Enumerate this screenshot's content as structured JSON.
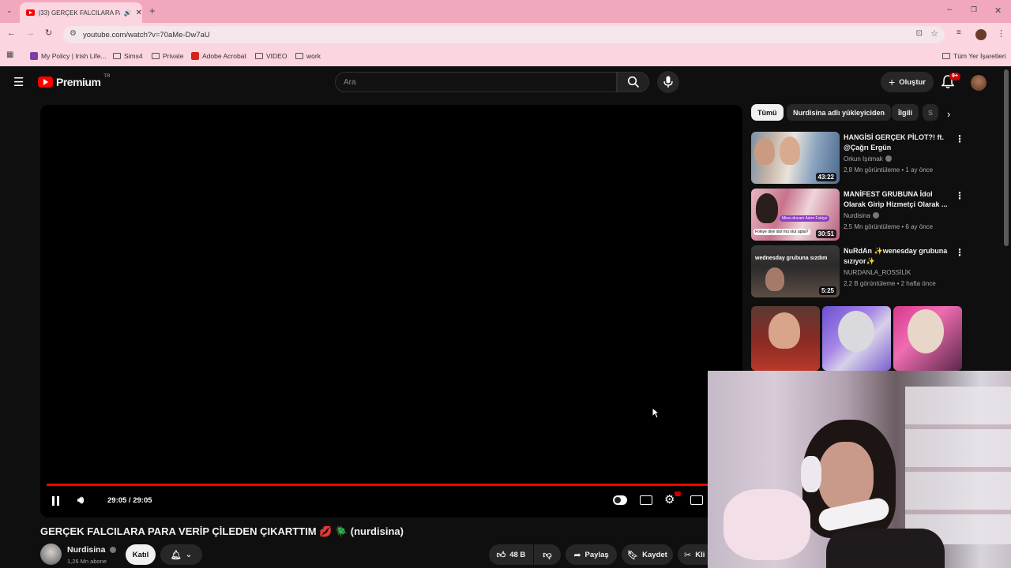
{
  "browser": {
    "tab_title": "(33) GERÇEK FALCILARA PA",
    "url": "youtube.com/watch?v=70aMe-Dw7aU",
    "bookmarks": [
      "My Policy | Irish Life...",
      "Sims4",
      "Private",
      "Adobe Acrobat",
      "VIDEO",
      "work"
    ],
    "all_bookmarks": "Tüm Yer İşaretleri"
  },
  "youtube": {
    "logo": "Premium",
    "region": "TR",
    "search_placeholder": "Ara",
    "create_label": "Oluştur",
    "notif_count": "9+"
  },
  "player": {
    "time": "29:05 / 29:05",
    "progress": 1.0,
    "title": "GERÇEK FALCILARA PARA VERİP ÇİLEDEN ÇIKARTTIM 💋 🪲 (nurdisina)",
    "channel": "Nurdisina",
    "subscribers": "1,26 Mn abone",
    "join_label": "Katıl",
    "likes": "48 B",
    "share_label": "Paylaş",
    "save_label": "Kaydet",
    "clip_label": "Kli"
  },
  "sidebar": {
    "chips": [
      "Tümü",
      "Nurdisina adlı yükleyiciden",
      "İlgili",
      "S"
    ],
    "recommendations": [
      {
        "title": "HANGİSİ GERÇEK PİLOT?! ft. @Çağrı Ergün",
        "channel": "Orkun Işıtmak",
        "meta": "2,8 Mn görüntüleme • 1 ay önce",
        "duration": "43:22"
      },
      {
        "title": "MANİFEST GRUBUNA İdol Olarak Girip Hizmetçi Olarak ...",
        "channel": "Nurdisina",
        "meta": "2,5 Mn görüntüleme • 6 ay önce",
        "duration": "30:51"
      },
      {
        "title": "NuRdAn ✨wenesday grubuna sızıyor✨",
        "channel": "NURDANLA_ROSSİLİK",
        "meta": "2,2 B görüntüleme • 2 hafta önce",
        "duration": "5:25"
      }
    ],
    "thumb2_caption_a": "Mina olucam Adım Fokiye",
    "thumb2_caption_b": "Fokiye diye idol mü olur aptal?",
    "thumb3_caption": "wednesday grubuna sızdım"
  },
  "colors": {
    "tabstrip": "#f1a8bd",
    "toolbar": "#fbd5df",
    "progress": "#ff0000",
    "background": "#0f0f0f"
  }
}
